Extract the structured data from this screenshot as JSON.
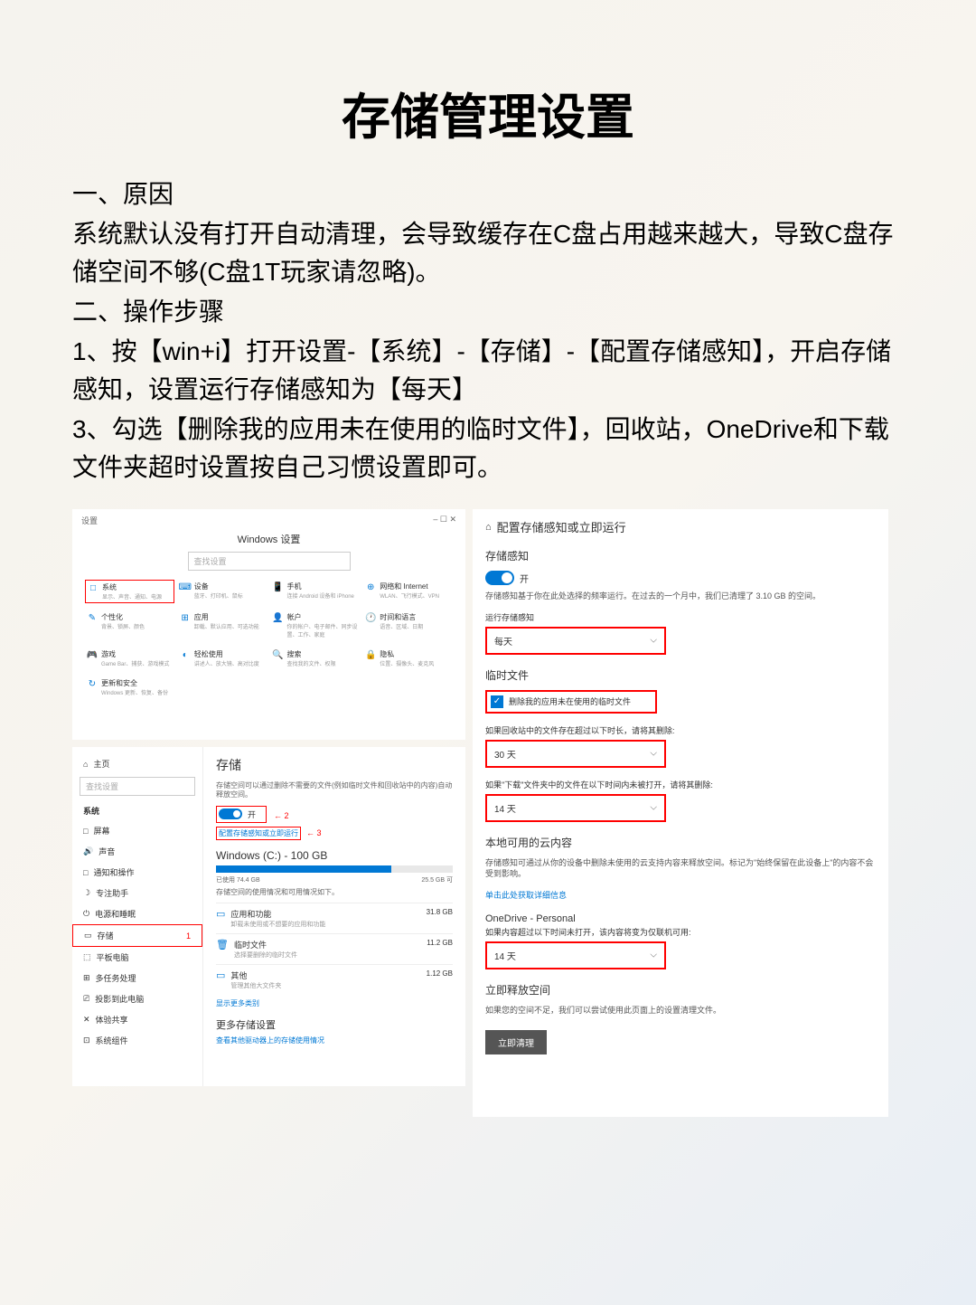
{
  "doc": {
    "title": "存储管理设置",
    "section1_label": "一、原因",
    "section1_text": "系统默认没有打开自动清理，会导致缓存在C盘占用越来越大，导致C盘存储空间不够(C盘1T玩家请忽略)。",
    "section2_label": "二、操作步骤",
    "step1": "1、按【win+i】打开设置-【系统】-【存储】-【配置存储感知】，开启存储感知，设置运行存储感知为【每天】",
    "step3": "3、勾选【删除我的应用未在使用的临时文件】，回收站，OneDrive和下载文件夹超时设置按自己习惯设置即可。"
  },
  "panel1": {
    "window_label": "设置",
    "title": "Windows 设置",
    "search_placeholder": "查找设置",
    "items": [
      {
        "icon": "□",
        "label": "系统",
        "desc": "显示、声音、通知、电源"
      },
      {
        "icon": "⌨",
        "label": "设备",
        "desc": "蓝牙、打印机、鼠标"
      },
      {
        "icon": "📱",
        "label": "手机",
        "desc": "连接 Android 设备和 iPhone"
      },
      {
        "icon": "⊕",
        "label": "网络和 Internet",
        "desc": "WLAN、飞行模式、VPN"
      },
      {
        "icon": "✎",
        "label": "个性化",
        "desc": "背景、锁屏、颜色"
      },
      {
        "icon": "⊞",
        "label": "应用",
        "desc": "卸载、默认应用、可选功能"
      },
      {
        "icon": "👤",
        "label": "帐户",
        "desc": "你的帐户、电子邮件、同步设置、工作、家庭"
      },
      {
        "icon": "🕐",
        "label": "时间和语言",
        "desc": "语音、区域、日期"
      },
      {
        "icon": "🎮",
        "label": "游戏",
        "desc": "Game Bar、捕获、游戏模式"
      },
      {
        "icon": "◐",
        "label": "轻松使用",
        "desc": "讲述人、放大镜、高对比度"
      },
      {
        "icon": "🔍",
        "label": "搜索",
        "desc": "查找我的文件、权限"
      },
      {
        "icon": "🔒",
        "label": "隐私",
        "desc": "位置、摄像头、麦克风"
      }
    ],
    "update_item": {
      "icon": "↻",
      "label": "更新和安全",
      "desc": "Windows 更新、恢复、备份"
    }
  },
  "panel2": {
    "home": "主页",
    "search_placeholder": "查找设置",
    "section_label": "系统",
    "nav": [
      {
        "icon": "□",
        "label": "屏幕"
      },
      {
        "icon": "🔊",
        "label": "声音"
      },
      {
        "icon": "□",
        "label": "通知和操作"
      },
      {
        "icon": "☽",
        "label": "专注助手"
      },
      {
        "icon": "⏻",
        "label": "电源和睡眠"
      },
      {
        "icon": "▭",
        "label": "存储"
      },
      {
        "icon": "⬚",
        "label": "平板电脑"
      },
      {
        "icon": "⊞",
        "label": "多任务处理"
      },
      {
        "icon": "⎚",
        "label": "投影到此电脑"
      },
      {
        "icon": "✕",
        "label": "体验共享"
      },
      {
        "icon": "⊡",
        "label": "系统组件"
      }
    ],
    "marker1": "1",
    "title": "存储",
    "desc": "存储空间可以通过删除不需要的文件(例如临时文件和回收站中的内容)自动释放空间。",
    "toggle_label": "开",
    "marker2": "2",
    "config_link": "配置存储感知或立即运行",
    "marker3": "3",
    "drive_title": "Windows (C:) - 100 GB",
    "used_label": "已使用 74.4 GB",
    "free_label": "25.5 GB 可",
    "usage_desc": "存储空间的使用情况和可用情况如下。",
    "items": [
      {
        "icon": "▭",
        "name": "应用和功能",
        "sub": "卸载未使用或不想要的应用和功能",
        "size": "31.8 GB"
      },
      {
        "icon": "🗑",
        "name": "临时文件",
        "sub": "选择要删除的临时文件",
        "size": "11.2 GB"
      },
      {
        "icon": "▭",
        "name": "其他",
        "sub": "管理其他大文件夹",
        "size": "1.12 GB"
      }
    ],
    "show_more": "显示更多类别",
    "more_title": "更多存储设置",
    "more_link": "查看其他驱动器上的存储使用情况"
  },
  "panel3": {
    "crumb": "配置存储感知或立即运行",
    "sense_title": "存储感知",
    "toggle_label": "开",
    "sense_desc": "存储感知基于你在此处选择的频率运行。在过去的一个月中，我们已清理了 3.10 GB 的空间。",
    "run_label": "运行存储感知",
    "run_value": "每天",
    "temp_title": "临时文件",
    "temp_check_label": "删除我的应用未在使用的临时文件",
    "recycle_label": "如果回收站中的文件存在超过以下时长，请将其删除:",
    "recycle_value": "30 天",
    "download_label": "如果\"下载\"文件夹中的文件在以下时间内未被打开，请将其删除:",
    "download_value": "14 天",
    "cloud_title": "本地可用的云内容",
    "cloud_desc": "存储感知可通过从你的设备中删除未使用的云支持内容来释放空间。标记为\"始终保留在此设备上\"的内容不会受到影响。",
    "cloud_link": "单击此处获取详细信息",
    "onedrive_title": "OneDrive - Personal",
    "onedrive_desc": "如果内容超过以下时间未打开，该内容将变为仅联机可用:",
    "onedrive_value": "14 天",
    "free_title": "立即释放空间",
    "free_desc": "如果您的空间不足，我们可以尝试使用此页面上的设置清理文件。",
    "free_button": "立即清理"
  }
}
